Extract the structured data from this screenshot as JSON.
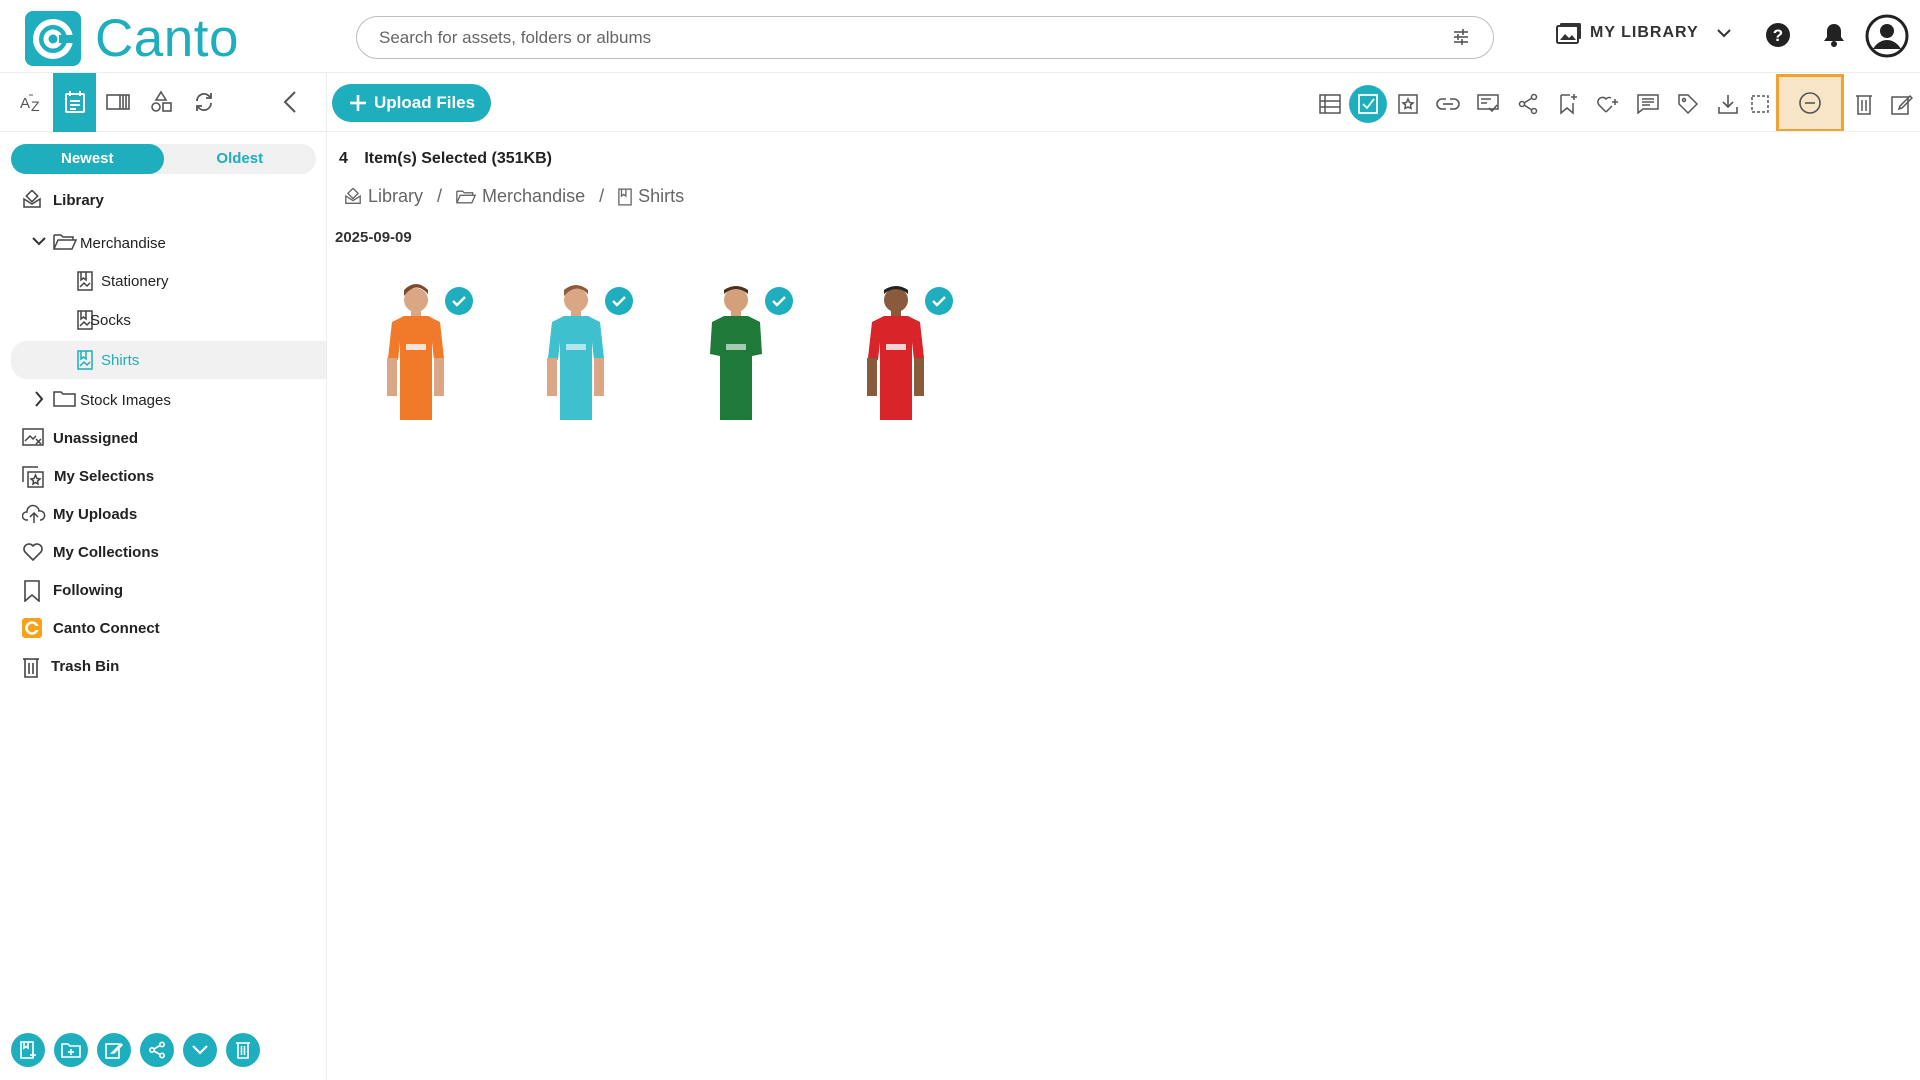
{
  "header": {
    "logo_text": "Canto",
    "search_placeholder": "Search for assets, folders or albums",
    "library_label": "MY LIBRARY"
  },
  "sidebar": {
    "sort_newest": "Newest",
    "sort_oldest": "Oldest",
    "tree": {
      "library": "Library",
      "merchandise": "Merchandise",
      "stationery": "Stationery",
      "socks": "Socks",
      "shirts": "Shirts",
      "stock_images": "Stock Images"
    },
    "sections": {
      "unassigned": "Unassigned",
      "my_selections": "My Selections",
      "my_uploads": "My Uploads",
      "my_collections": "My Collections",
      "following": "Following",
      "canto_connect": "Canto Connect",
      "trash_bin": "Trash Bin"
    }
  },
  "main": {
    "upload_label": "Upload Files",
    "selection_count": "4",
    "selection_text": "Item(s) Selected (351KB)",
    "breadcrumb": [
      "Library",
      "Merchandise",
      "Shirts"
    ],
    "date_group": "2025-09-09",
    "assets": [
      {
        "shirt_color": "#f07a2a"
      },
      {
        "shirt_color": "#3fc0cf"
      },
      {
        "shirt_color": "#1f7a3a"
      },
      {
        "shirt_color": "#d9252a"
      }
    ]
  },
  "colors": {
    "accent": "#1eaebd",
    "highlight": "#f0a233"
  }
}
